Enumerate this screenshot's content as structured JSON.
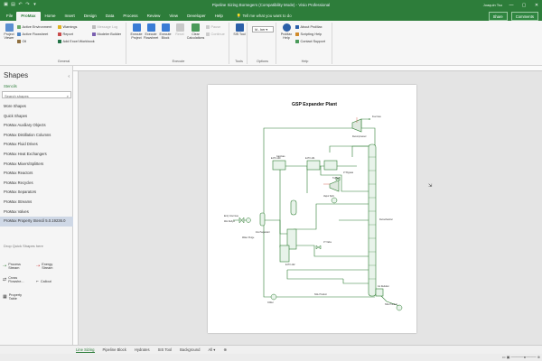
{
  "window": {
    "title": "Pipeline Sizing Bornegers  (Compatibility Mode)  -  Visio Professional",
    "user": "Joaquin Tsu",
    "controls": [
      "—",
      "▢",
      "✕"
    ]
  },
  "tabs": [
    "File",
    "ProMax",
    "Home",
    "Insert",
    "Design",
    "Data",
    "Process",
    "Review",
    "View",
    "Developer",
    "Help"
  ],
  "active_tab": "ProMax",
  "tell_me": "Tell me what you want to do",
  "share": "Share",
  "comments": "Comments",
  "ribbon": {
    "general": {
      "label": "General",
      "project_viewer": "Project Viewer",
      "active_environment": "Active Environment",
      "active_flowsheet": "Active Flowsheet",
      "oil": "Oil",
      "warnings": "Warnings",
      "report": "Report",
      "add_excel_workbook": "Add Excel Workbook",
      "message_log": "Message Log",
      "modeler_builder": "Modeler Builder"
    },
    "execute": {
      "label": "Execute",
      "execute_project": "Execute Project",
      "execute_flowsheet": "Execute Flowsheet",
      "execute_block": "Execute Block",
      "reset": "Reset",
      "clear_calculations": "Clear Calculations",
      "pause": "Pause",
      "continue": "Continue"
    },
    "tools": {
      "label": "Tools",
      "sis_tool": "SIS Tool"
    },
    "options": {
      "label": "Options",
      "units": "Id - ber"
    },
    "help": {
      "label": "Help",
      "promax_help": "ProMax Help",
      "about_promax": "About ProMax",
      "scripting_help": "Scripting Help",
      "contact_support": "Contact Support"
    }
  },
  "shapes_panel": {
    "header": "Shapes",
    "stencils_label": "Stencils",
    "search_placeholder": "Search shapes",
    "items": [
      "More Shapes",
      "Quick Shapes",
      "ProMax Auxiliary Objects",
      "ProMax Distillation Columns",
      "ProMax Fluid Drives",
      "ProMax Heat Exchangers",
      "ProMax Mixers/Splitters",
      "ProMax Reactors",
      "ProMax Recycles",
      "ProMax Separators",
      "ProMax Streams",
      "ProMax Valves",
      "ProMax Property Stencil 5.0.19236.0"
    ],
    "selected_index": 12,
    "drop_hint": "Drop Quick Shapes here",
    "stencil_shapes": [
      "Process Stream",
      "Energy Stream",
      "Cross Flowshe...",
      "Callout",
      "Property Table"
    ]
  },
  "diagram": {
    "title": "GSP Expander Plant",
    "labels": {
      "fuel_gas": "Fuel Gas",
      "recompressor": "Recompressor",
      "inlet_gas": "Entry Inlet Gas",
      "wet_dehy": "Wet Dehyd",
      "inlet_separator": "Inlet Separator",
      "water": "Water Purge",
      "gas_gas": "Gas/Gas",
      "vapor_split": "Vapor Split",
      "turbine": "Turbine",
      "jt_valve": "JT Valve",
      "demethanizer": "Demethanizer",
      "ngl_product": "NGL Product",
      "reboiler": "1st Reboiler",
      "chiller": "Chiller",
      "ngl_product_bottom": "NGL Product",
      "jt_bypass": "JT Bypass",
      "hx1": "E-HX-100",
      "hx2": "E-HX-101",
      "hx3": "E-HX-102"
    }
  },
  "page_tabs": [
    "Line Sizing",
    "Pipeline Block",
    "Hydrates",
    "SIS Tool",
    "Background",
    "All ▾",
    "⊕"
  ],
  "active_page_tab": "Line Sizing",
  "colors": {
    "accent": "#2d7d3a",
    "stream": "#2e7d32",
    "equipment": "#4a8f5c"
  }
}
